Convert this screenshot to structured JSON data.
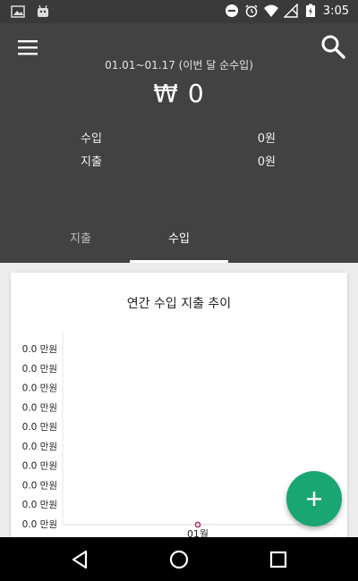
{
  "status_bar": {
    "time": "3:05"
  },
  "header": {
    "period": "01.01~01.17 (이번 달 순수입)",
    "net_amount": "₩ 0",
    "income_label": "수입",
    "income_value": "0원",
    "expense_label": "지출",
    "expense_value": "0원"
  },
  "tabs": [
    {
      "label": "지출",
      "selected": false
    },
    {
      "label": "수입",
      "selected": true
    }
  ],
  "colors": {
    "header_bg": "#424242",
    "fab": "#1aa672",
    "point": "#b0306a"
  },
  "chart_data": {
    "type": "line",
    "title": "연간 수입 지출 추이",
    "categories": [
      "01월"
    ],
    "series": [
      {
        "values": [
          0.0
        ]
      }
    ],
    "y_tick_labels": [
      "0.0 만원",
      "0.0 만원",
      "0.0 만원",
      "0.0 만원",
      "0.0 만원",
      "0.0 만원",
      "0.0 만원",
      "0.0 만원",
      "0.0 만원",
      "0.0 만원"
    ]
  },
  "icons": {
    "menu": "menu-icon",
    "search": "search-icon",
    "fab": "plus-icon",
    "back": "back-icon",
    "home": "home-icon",
    "recents": "recents-icon"
  }
}
